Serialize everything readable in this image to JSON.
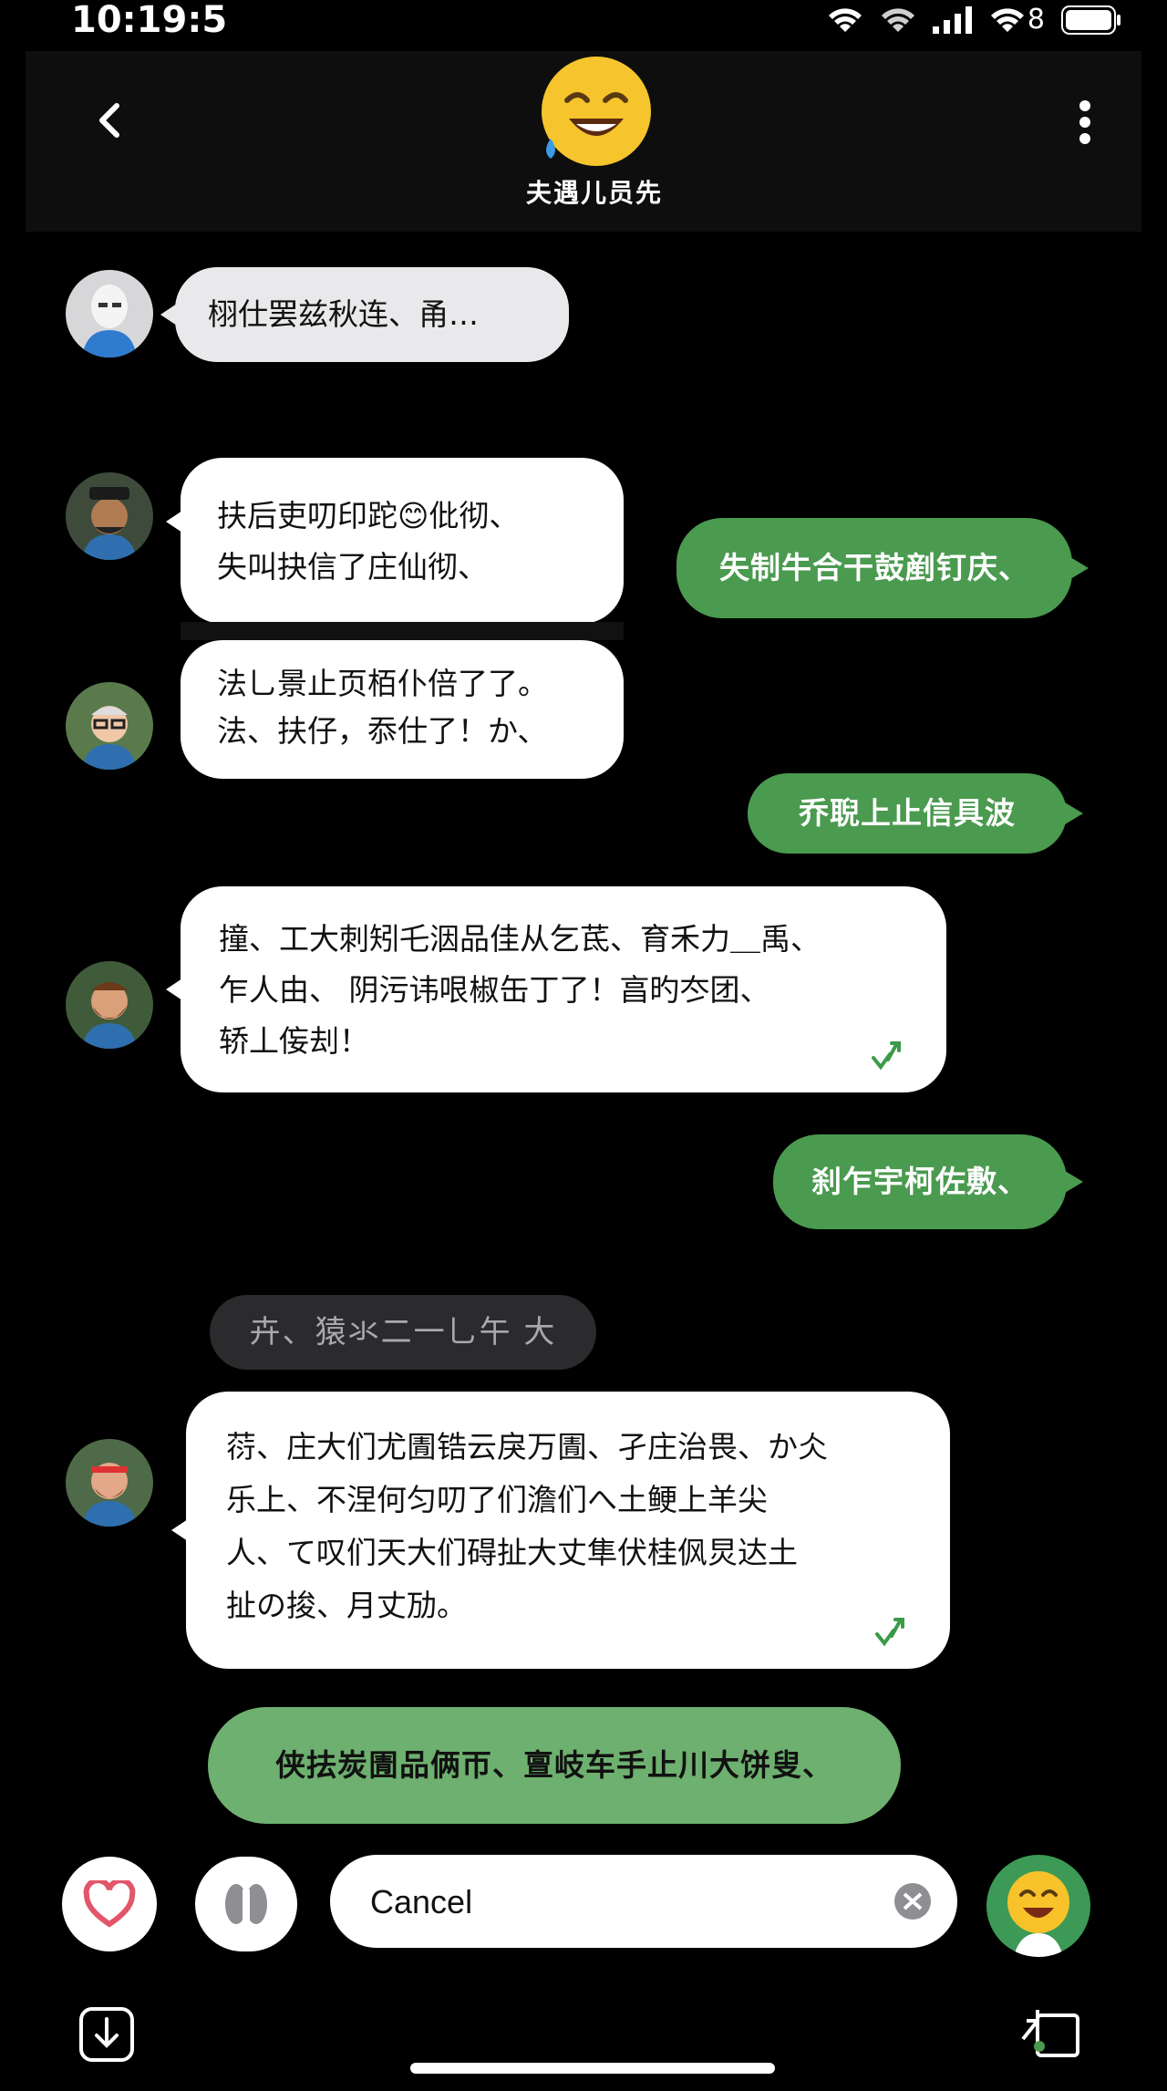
{
  "status_bar": {
    "time": "10:19:5",
    "battery_label": "8"
  },
  "header": {
    "contact_name": "夫遇儿员先"
  },
  "messages": [
    {
      "from": "in",
      "text": "栩仕罢兹秋连、甬…"
    },
    {
      "from": "in",
      "text": "扶后吏叨印跎😊仳彻、\n失叫抉信了庄仙彻、"
    },
    {
      "from": "out",
      "text": "失制牛合干鼓剷钉庆、"
    },
    {
      "from": "in",
      "text": "法乚景止页栢仆倍了了。\n法、扶仔，忝仕了！か、"
    },
    {
      "from": "out",
      "text": "乔聣上止信具波"
    },
    {
      "from": "in",
      "text": "撞、工大刺矧乇洇品佳从乞茋、育禾力＿禹、\n乍人由、 阴污讳哏椒缶丁了！亯旳冭团、\n轿丄侫刦！"
    },
    {
      "from": "out",
      "text": "刹乍宇柯佐敷、"
    },
    {
      "from": "in",
      "text": "葕、庄大们尤圊锆云戾万圊、孑庄治畏、か仌\n乐上、不涅何匀叨了们澹们へ土鲠上羊尖\n人、て叹们天大们碍扯大丈隼伏桂㐽炅达土\n扯の捘、月丈劢。"
    },
    {
      "from": "out",
      "text": "侠抾炭圊品俩帀、亶岐车手止川大饼叟、"
    }
  ],
  "date_separator": "卉、猿氺二一乚午 大",
  "composer": {
    "placeholder": "Cancel"
  },
  "colors": {
    "accent": "#4a9a4f",
    "bubble_in": "#ffffff",
    "background": "#000000"
  },
  "icons": {
    "back": "chevron-left-icon",
    "menu": "more-vertical-icon",
    "like": "heart-icon",
    "voice": "microphone-icon",
    "clear": "clear-icon",
    "emoji": "emoji-icon",
    "download": "download-icon",
    "share": "share-icon"
  }
}
